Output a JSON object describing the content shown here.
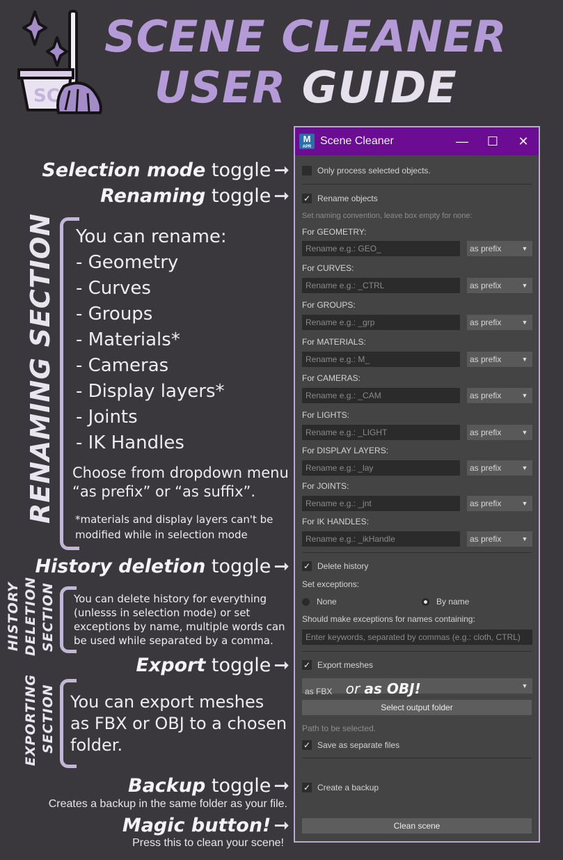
{
  "title": {
    "line1_a": "SCENE ",
    "line1_b": "CLEANER",
    "line2_a": "USER ",
    "line2_b": "GUIDE"
  },
  "annotations": {
    "selection": {
      "em": "Selection mode",
      "rest": " toggle"
    },
    "renaming": {
      "em": "Renaming",
      "rest": " toggle"
    },
    "history": {
      "em": "History deletion",
      "rest": " toggle"
    },
    "export": {
      "em": "Export",
      "rest": " toggle"
    },
    "backup": {
      "em": "Backup",
      "rest": " toggle",
      "sub": "Creates a backup in the same folder as your file."
    },
    "magic": {
      "em": "Magic button!",
      "sub": "Press this to clean your scene!"
    },
    "arrow": "➞"
  },
  "renaming_section": {
    "label": "RENAMING SECTION",
    "intro": "You can rename:",
    "items": [
      "-   Geometry",
      "-   Curves",
      "-   Groups",
      "-   Materials*",
      "-   Cameras",
      "-   Display layers*",
      "-   Joints",
      "-   IK Handles"
    ],
    "note1": "Choose from dropdown menu",
    "note2": "“as prefix” or “as suffix”.",
    "foot1": "*materials and display layers can't be",
    "foot2": "modified while in selection mode"
  },
  "history_section": {
    "label1": "HISTORY",
    "label2": "DELETION",
    "label3": "SECTION",
    "lines": [
      "You can delete history for everything",
      "(unlesss in selection mode) or set",
      "exceptions by name, multiple words can",
      "be used while separated by a comma."
    ]
  },
  "export_section": {
    "label1": "EXPORTING",
    "label2": "SECTION",
    "lines": [
      "You can export meshes",
      "as FBX or OBJ to a chosen",
      "folder."
    ]
  },
  "window": {
    "app_icon": "M",
    "app_icon_sub": "APR",
    "title": "Scene Cleaner",
    "minimize_glyph": "—",
    "maximize_glyph": "☐",
    "close_glyph": "✕",
    "check_glyph": "✓",
    "dropdown_glyph": "▼",
    "only_selected": "Only process selected objects.",
    "rename_objects": "Rename objects",
    "naming_hint": "Set naming convention, leave box empty for none:",
    "rename_rows": [
      {
        "label": "For GEOMETRY:",
        "placeholder": "Rename e.g.: GEO_",
        "mode": "as prefix"
      },
      {
        "label": "For CURVES:",
        "placeholder": "Rename e.g.: _CTRL",
        "mode": "as prefix"
      },
      {
        "label": "For GROUPS:",
        "placeholder": "Rename e.g.: _grp",
        "mode": "as prefix"
      },
      {
        "label": "For MATERIALS:",
        "placeholder": "Rename e.g.: M_",
        "mode": "as prefix"
      },
      {
        "label": "For CAMERAS:",
        "placeholder": "Rename e.g.: _CAM",
        "mode": "as prefix"
      },
      {
        "label": "For LIGHTS:",
        "placeholder": "Rename e.g.: _LIGHT",
        "mode": "as prefix"
      },
      {
        "label": "For DISPLAY LAYERS:",
        "placeholder": "Rename e.g.: _lay",
        "mode": "as prefix"
      },
      {
        "label": "For JOINTS:",
        "placeholder": "Rename e.g.: _jnt",
        "mode": "as prefix"
      },
      {
        "label": "For IK HANDLES:",
        "placeholder": "Rename e.g.: _ikHandle",
        "mode": "as prefix"
      }
    ],
    "delete_history": "Delete history",
    "set_exceptions": "Set exceptions:",
    "radio_none": "None",
    "radio_by_name": "By name",
    "exceptions_label": "Should make exceptions for names containing:",
    "exceptions_placeholder": "Enter keywords, separated by commas (e.g.: cloth, CTRL)",
    "export_meshes": "Export meshes",
    "format_value": "as FBX",
    "format_overlay_a": "or ",
    "format_overlay_b": "as OBJ!",
    "select_output": "Select output folder",
    "path_text": "Path to be selected.",
    "separate_files": "Save as separate files",
    "create_backup": "Create a backup",
    "clean_scene": "Clean scene"
  }
}
